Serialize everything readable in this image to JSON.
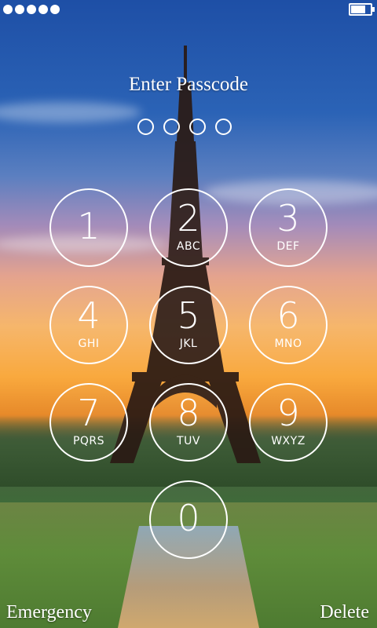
{
  "status_bar": {
    "signal_dots": 5,
    "battery_level": 0.75
  },
  "lockscreen": {
    "title": "Enter Passcode",
    "passcode_length": 4,
    "keys": [
      {
        "digit": "1",
        "letters": ""
      },
      {
        "digit": "2",
        "letters": "ABC"
      },
      {
        "digit": "3",
        "letters": "DEF"
      },
      {
        "digit": "4",
        "letters": "GHI"
      },
      {
        "digit": "5",
        "letters": "JKL"
      },
      {
        "digit": "6",
        "letters": "MNO"
      },
      {
        "digit": "7",
        "letters": "PQRS"
      },
      {
        "digit": "8",
        "letters": "TUV"
      },
      {
        "digit": "9",
        "letters": "WXYZ"
      },
      {
        "digit": "0",
        "letters": ""
      }
    ],
    "emergency_label": "Emergency",
    "delete_label": "Delete"
  },
  "colors": {
    "ui_foreground": "#ffffff",
    "sky_top": "#1e4fa6",
    "sunset": "#f9a93e",
    "grass": "#4f7e3a"
  },
  "wallpaper": "eiffel-tower-sunset"
}
